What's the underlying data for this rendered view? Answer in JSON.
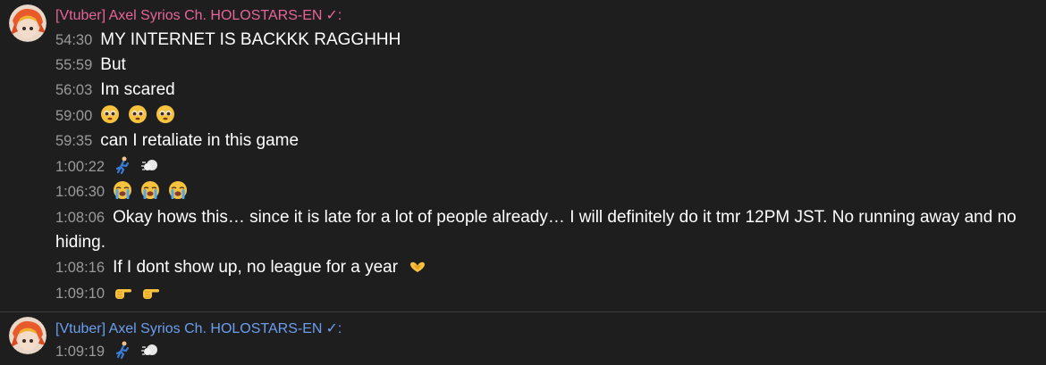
{
  "groups": [
    {
      "author": "[Vtuber] Axel Syrios Ch. HOLOSTARS-EN",
      "verified": "✓:",
      "author_color": "#e8649a",
      "messages": [
        {
          "time": "54:30",
          "text": "MY INTERNET IS BACKKK RAGGHHH"
        },
        {
          "time": "55:59",
          "text": "But"
        },
        {
          "time": "56:03",
          "text": "Im scared"
        },
        {
          "time": "59:00",
          "emojis": [
            "pleading-face",
            "pleading-face",
            "pleading-face"
          ]
        },
        {
          "time": "59:35",
          "text": "can I retaliate in this game"
        },
        {
          "time": "1:00:22",
          "emojis": [
            "running-person",
            "dash-cloud"
          ]
        },
        {
          "time": "1:06:30",
          "emojis": [
            "loudly-crying-face",
            "loudly-crying-face",
            "loudly-crying-face"
          ]
        },
        {
          "time": "1:08:06",
          "text": "Okay hows this… since it is late for a lot of people already… I will definitely do it tmr 12PM JST. No running away and no hiding."
        },
        {
          "time": "1:08:16",
          "text": "If I dont show up, no league for a year",
          "emojis": [
            "heart-hands"
          ]
        },
        {
          "time": "1:09:10",
          "emojis": [
            "pointing-right",
            "pointing-right"
          ]
        }
      ]
    },
    {
      "author": "[Vtuber] Axel Syrios Ch. HOLOSTARS-EN",
      "verified": "✓:",
      "author_color": "#6c9ef0",
      "messages": [
        {
          "time": "1:09:19",
          "emojis": [
            "running-person",
            "dash-cloud"
          ]
        }
      ]
    }
  ]
}
